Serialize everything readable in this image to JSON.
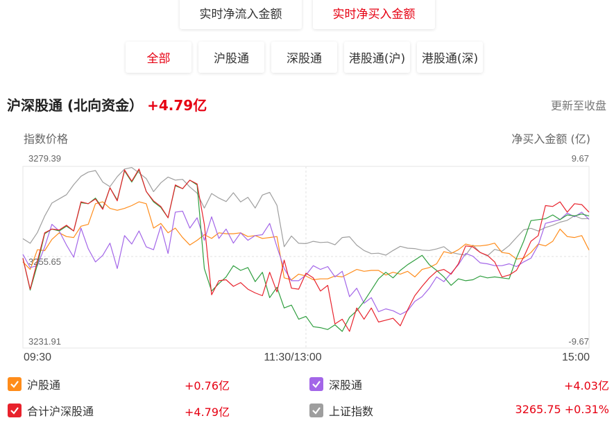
{
  "modes": [
    {
      "label": "实时净流入金额",
      "active": false
    },
    {
      "label": "实时净买入金额",
      "active": true
    }
  ],
  "tabs": [
    {
      "label": "全部",
      "active": true
    },
    {
      "label": "沪股通",
      "active": false
    },
    {
      "label": "深股通",
      "active": false
    },
    {
      "label": "港股通(沪)",
      "active": false
    },
    {
      "label": "港股通(深)",
      "active": false
    }
  ],
  "header": {
    "title": "沪深股通 (北向资金）",
    "value": "+4.79亿",
    "update_status": "更新至收盘"
  },
  "colors": {
    "sh": "#ff8c1a",
    "sz": "#a366e8",
    "total": "#e8222c",
    "index": "#9e9e9e",
    "green": "#2e9e3e",
    "red": "#e60012"
  },
  "chart_data": {
    "type": "line",
    "left_axis_title": "指数价格",
    "right_axis_title": "净买入金额 (亿)",
    "left_ticks": [
      "3279.39",
      "3255.65",
      "3231.91"
    ],
    "right_ticks": [
      "9.67",
      "-9.67"
    ],
    "x_ticks": [
      "09:30",
      "11:30/13:00",
      "15:00"
    ],
    "left_range": [
      3231.91,
      3279.39
    ],
    "right_range": [
      -9.67,
      9.67
    ],
    "grid": true,
    "legend_placement": "bottom",
    "series": [
      {
        "name": "上证指数",
        "axis": "left",
        "color_key": "index",
        "values": [
          3260.5,
          3259.3,
          3262.1,
          3266.4,
          3269.8,
          3270.9,
          3272.0,
          3274.6,
          3276.8,
          3277.9,
          3278.3,
          3275.3,
          3274.1,
          3276.7,
          3278.7,
          3279.1,
          3277.7,
          3276.2,
          3272.8,
          3275.1,
          3276.6,
          3275.8,
          3276.0,
          3274.0,
          3272.4,
          3268.5,
          3272.3,
          3271.1,
          3270.2,
          3272.5,
          3270.1,
          3271.3,
          3268.5,
          3271.9,
          3272.6,
          3269.2,
          3258.4,
          3261.2,
          3259.3,
          3259.2,
          3259.8,
          3259.5,
          3259.6,
          3258.9,
          3260.8,
          3261.0,
          3258.8,
          3257.4,
          3256.6,
          3256.7,
          3256.2,
          3257.4,
          3258.5,
          3258.0,
          3257.9,
          3257.5,
          3257.4,
          3257.8,
          3258.4,
          3256.9,
          3256.5,
          3256.2,
          3258.8,
          3256.9,
          3256.0,
          3257.7,
          3257.2,
          3258.7,
          3260.8,
          3262.8,
          3263.2,
          3262.5,
          3263.4,
          3264.0,
          3264.8,
          3265.3,
          3266.5,
          3265.7,
          3265.75
        ]
      },
      {
        "name": "沪股通",
        "axis": "right",
        "color_key": "sh",
        "values": [
          -0.5,
          -1.3,
          0.8,
          0.7,
          1.9,
          2.6,
          2.2,
          2.1,
          3.3,
          3.5,
          5.7,
          5.9,
          5.2,
          5.0,
          5.2,
          5.5,
          5.9,
          5.7,
          3.1,
          3.6,
          2.6,
          3.1,
          2.1,
          1.3,
          1.8,
          2.4,
          2.0,
          2.6,
          2.5,
          2.5,
          2.6,
          2.2,
          2.3,
          2.0,
          2.1,
          2.2,
          -2.2,
          -2.4,
          -1.8,
          -2.0,
          -2.4,
          -2.3,
          -2.3,
          -2.0,
          -2.1,
          -1.7,
          -1.3,
          -1.5,
          -1.4,
          -1.4,
          -1.9,
          -1.6,
          -1.8,
          -1.5,
          -2.1,
          -1.3,
          -1.1,
          -0.7,
          0.6,
          0.4,
          0.8,
          1.4,
          1.2,
          1.2,
          1.3,
          1.5,
          0.5,
          0.4,
          -0.2,
          -0.1,
          0.5,
          1.4,
          1.2,
          1.7,
          3.0,
          2.2,
          2.1,
          2.3,
          0.76
        ]
      },
      {
        "name": "深股通",
        "axis": "right",
        "color_key": "sz",
        "values": [
          0.3,
          -1.1,
          -0.9,
          1.1,
          3.5,
          2.8,
          1.3,
          0.0,
          3.1,
          0.9,
          -0.5,
          0.2,
          1.5,
          -1.2,
          2.3,
          1.4,
          2.8,
          1.1,
          0.8,
          3.3,
          0.4,
          4.8,
          4.9,
          3.1,
          4.2,
          1.8,
          4.3,
          2.0,
          3.0,
          1.5,
          2.6,
          1.8,
          2.3,
          2.4,
          3.6,
          1.1,
          -1.2,
          -2.5,
          -2.5,
          -1.9,
          -0.9,
          -1.3,
          -1.0,
          -2.1,
          -1.5,
          -4.2,
          -3.3,
          -4.9,
          -4.3,
          -5.8,
          -5.5,
          -5.7,
          -6.1,
          -5.7,
          -4.7,
          -4.2,
          -3.3,
          -2.1,
          -2.6,
          -1.7,
          -0.8,
          0.4,
          0.1,
          -0.6,
          -0.7,
          -0.9,
          -0.9,
          -0.7,
          -1.0,
          -0.5,
          -0.1,
          1.3,
          3.6,
          3.8,
          4.0,
          4.7,
          4.3,
          4.8,
          4.03
        ]
      },
      {
        "name": "合计沪深股通",
        "axis": "right",
        "color_key": "total",
        "values": [
          -0.1,
          -3.4,
          -0.4,
          2.6,
          3.0,
          2.9,
          3.4,
          2.8,
          5.9,
          5.7,
          6.2,
          5.1,
          7.4,
          6.0,
          9.3,
          8.1,
          9.4,
          7.0,
          6.0,
          5.4,
          4.2,
          7.7,
          7.3,
          8.2,
          7.8,
          3.5,
          -4.0,
          -2.5,
          -2.4,
          -3.1,
          -2.7,
          -3.4,
          -3.8,
          -4.1,
          -1.6,
          -3.7,
          -0.3,
          -3.3,
          -3.4,
          -1.7,
          -2.2,
          -3.6,
          -3.0,
          -7.1,
          -6.6,
          -7.9,
          -5.4,
          -6.6,
          -5.4,
          -6.9,
          -6.7,
          -6.5,
          -7.3,
          -5.6,
          -4.1,
          -3.1,
          -2.2,
          -1.5,
          -1.3,
          -1.8,
          -0.7,
          1.2,
          1.1,
          0.5,
          0.2,
          -0.5,
          -2.1,
          -1.9,
          -1.4,
          0.0,
          1.7,
          2.3,
          5.5,
          5.4,
          5.9,
          4.8,
          5.7,
          5.6,
          4.79
        ]
      },
      {
        "name": "",
        "axis": "right",
        "color_key": "green",
        "values": [
          -0.1,
          -3.5,
          -0.8,
          2.5,
          3.0,
          2.8,
          3.3,
          2.8,
          5.8,
          5.7,
          6.3,
          5.2,
          7.4,
          6.1,
          9.2,
          8.0,
          9.3,
          7.0,
          5.9,
          5.3,
          4.2,
          7.6,
          7.3,
          8.2,
          7.7,
          -1.2,
          -3.6,
          -2.8,
          -2.1,
          -0.9,
          -1.4,
          -1.1,
          -2.6,
          -1.6,
          -4.3,
          -3.2,
          -5.4,
          -5.1,
          -6.6,
          -6.3,
          -7.4,
          -7.5,
          -7.7,
          -7.2,
          -7.9,
          -6.4,
          -5.7,
          -4.7,
          -3.5,
          -2.3,
          -1.6,
          -2.2,
          -1.4,
          -0.8,
          -0.3,
          0.2,
          -0.8,
          -1.4,
          -2.1,
          -3.0,
          -2.3,
          -2.5,
          -2.4,
          -2.0,
          -2.2,
          -2.1,
          -2.2,
          -2.3,
          -0.1,
          1.7,
          3.9,
          4.0,
          4.1,
          4.5,
          4.0,
          4.5,
          4.4,
          4.6,
          4.4
        ]
      }
    ]
  },
  "legend": [
    {
      "label": "沪股通",
      "value": "+0.76亿",
      "color_key": "sh"
    },
    {
      "label": "深股通",
      "value": "+4.03亿",
      "color_key": "sz"
    },
    {
      "label": "合计沪深股通",
      "value": "+4.79亿",
      "color_key": "total"
    },
    {
      "label": "上证指数",
      "value": "3265.75 +0.31%",
      "color_key": "index"
    }
  ]
}
